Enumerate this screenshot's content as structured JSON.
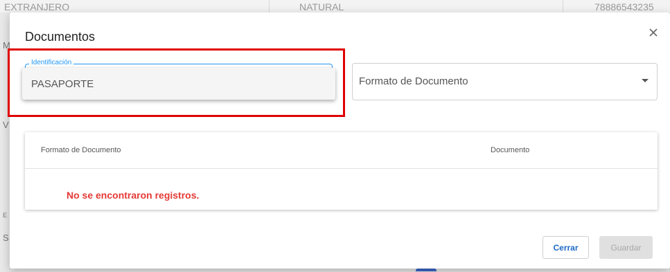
{
  "background": {
    "row": {
      "col1": "EXTRANJERO",
      "col2": "NATURAL",
      "col3": "78886543235"
    },
    "left_chars": [
      "M",
      "V",
      "E",
      "S"
    ]
  },
  "dialog": {
    "title": "Documentos",
    "close_icon": "close-icon",
    "identificacion": {
      "label": "Identificación",
      "options": [
        "PASAPORTE"
      ]
    },
    "formato": {
      "placeholder": "Formato de Documento"
    },
    "table": {
      "columns": [
        "Formato de Documento",
        "Documento"
      ],
      "empty_message": "No se encontraron registros."
    },
    "buttons": {
      "cerrar": "Cerrar",
      "guardar": "Guardar"
    }
  },
  "colors": {
    "accent": "#2196f3",
    "error": "#e53935",
    "highlight": "#e00000",
    "primary_text_button": "#1e6ac8"
  }
}
